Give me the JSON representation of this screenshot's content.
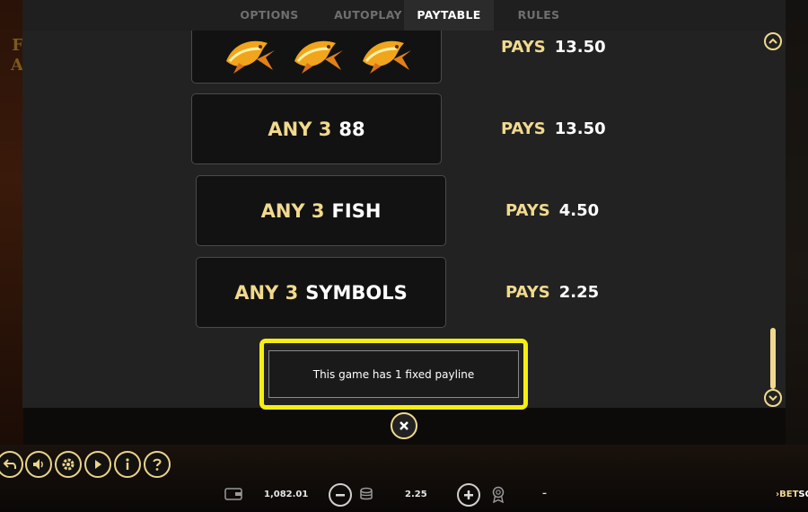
{
  "tabs": [
    {
      "label": "OPTIONS",
      "active": false
    },
    {
      "label": "AUTOPLAY",
      "active": false
    },
    {
      "label": "PAYTABLE",
      "active": true
    },
    {
      "label": "RULES",
      "active": false
    }
  ],
  "paytable": {
    "rows": [
      {
        "combo_prefix": "",
        "combo_symbol": "",
        "icon": "golden-koi-fish-icon",
        "pays_label": "PAYS",
        "pays_value": "13.50"
      },
      {
        "combo_prefix": "ANY 3",
        "combo_symbol": "88",
        "pays_label": "PAYS",
        "pays_value": "13.50"
      },
      {
        "combo_prefix": "ANY 3",
        "combo_symbol": "FISH",
        "pays_label": "PAYS",
        "pays_value": "4.50"
      },
      {
        "combo_prefix": "ANY 3",
        "combo_symbol": "SYMBOLS",
        "pays_label": "PAYS",
        "pays_value": "2.25"
      }
    ],
    "payline_note": "This game has 1 fixed payline"
  },
  "bottom_bar": {
    "balance": "1,082.01",
    "bet": "2.25",
    "win": "–",
    "brand_prefix": "BET",
    "brand_suffix": "SOFT"
  },
  "icons": {
    "back": "back-arrow-icon",
    "sound": "speaker-icon",
    "settings": "gear-icon",
    "autoplay": "autoplay-icon",
    "info": "info-icon",
    "help": "question-mark-icon",
    "wallet": "wallet-icon",
    "minus": "minus-icon",
    "coins": "coin-stack-icon",
    "plus": "plus-icon",
    "award": "award-ribbon-icon",
    "close": "close-icon"
  },
  "colors": {
    "accent_gold": "#f1d98e",
    "highlight_yellow": "#f5ee10",
    "panel_bg": "#222222",
    "box_bg": "#121212"
  }
}
